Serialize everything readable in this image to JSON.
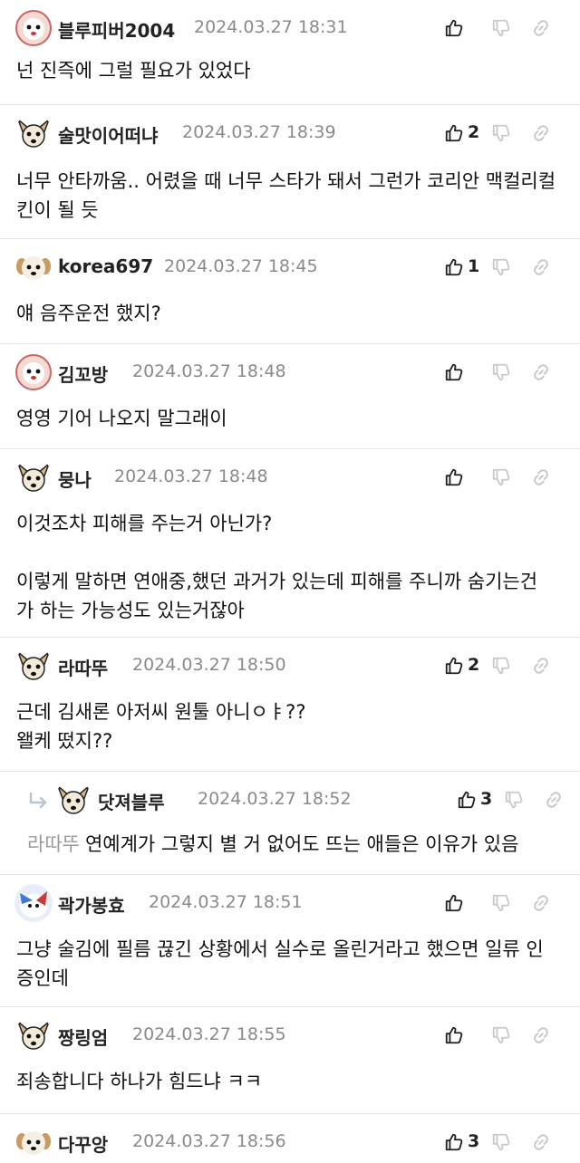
{
  "comments": [
    {
      "nick": "블루피버2004",
      "date": "2024.03.27 18:31",
      "likes": "",
      "body": "넌 진즉에 그럴 필요가 있었다",
      "avatar": "mascot-face-avatar"
    },
    {
      "nick": "술맛이어떠냐",
      "date": "2024.03.27 18:39",
      "likes": "2",
      "body": "너무 안타까움.. 어렸을 때 너무 스타가 돼서 그런가 코리안 맥컬리컬\n킨이 될 듯",
      "avatar": "dog-avatar"
    },
    {
      "nick": "korea697",
      "date": "2024.03.27 18:45",
      "likes": "1",
      "body": "얘 음주운전 했지?",
      "avatar": "puppy-avatar"
    },
    {
      "nick": "김꼬방",
      "date": "2024.03.27 18:48",
      "likes": "",
      "body": "영영 기어 나오지 말그래이",
      "avatar": "mascot-face-avatar"
    },
    {
      "nick": "뭉나",
      "date": "2024.03.27 18:48",
      "likes": "",
      "body": "이것조차 피해를 주는거 아닌가?\n\n이렇게 말하면 연애중,했던 과거가 있는데 피해를 주니까 숨기는건\n가 하는 가능성도 있는거잖아",
      "avatar": "dog-avatar"
    },
    {
      "nick": "라따뚜",
      "date": "2024.03.27 18:50",
      "likes": "2",
      "body": "근데 김새론 아저씨 원툴 아니ㅇㅑ??\n왤케 떴지??",
      "avatar": "dog-avatar"
    },
    {
      "nick": "닷져블루",
      "date": "2024.03.27 18:52",
      "likes": "3",
      "reply_to": "라따뚜",
      "body": "연예계가 그렇지 별 거 없어도 뜨는 애들은 이유가 있음",
      "avatar": "dog-avatar",
      "reply": true
    },
    {
      "nick": "곽가봉효",
      "date": "2024.03.27 18:51",
      "likes": "",
      "body": "그냥 술김에 필름 끊긴 상황에서 실수로 올린거라고 했으면 일류 인\n증인데",
      "avatar": "blue-bird-avatar"
    },
    {
      "nick": "짱링엄",
      "date": "2024.03.27 18:55",
      "likes": "",
      "body": "죄송합니다 하나가 힘드냐 ㅋㅋ",
      "avatar": "dog-avatar"
    },
    {
      "nick": "다꾸앙",
      "date": "2024.03.27 18:56",
      "likes": "3",
      "body": "",
      "avatar": "puppy-avatar"
    }
  ],
  "icons": {
    "like": "thumbs-up-icon",
    "dislike": "thumbs-down-icon",
    "share": "link-icon",
    "reply": "reply-arrow-icon"
  }
}
